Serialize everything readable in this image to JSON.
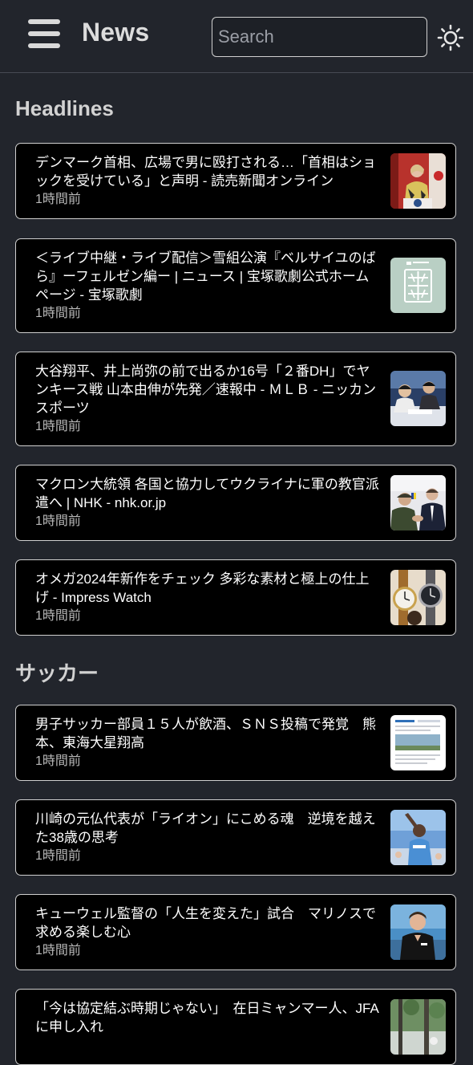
{
  "app": {
    "title": "News"
  },
  "search": {
    "placeholder": "Search",
    "value": ""
  },
  "sections": [
    {
      "title": "Headlines",
      "items": [
        {
          "title": "デンマーク首相、広場で男に殴打される…「首相はショックを受けている」と声明 - 読売新聞オンライン",
          "time": "1時間前",
          "thumb_icon": "woman-at-podium-photo"
        },
        {
          "title": "＜ライブ中継・ライブ配信＞雪組公演『ベルサイユのばら』ーフェルゼン編ー | ニュース | 宝塚歌劇公式ホームページ - 宝塚歌劇",
          "time": "1時間前",
          "thumb_icon": "takarazuka-logo"
        },
        {
          "title": "大谷翔平、井上尚弥の前で出るか16号「２番DH」でヤンキース戦 山本由伸が先発／速報中 - ＭＬＢ - ニッカンスポーツ",
          "time": "1時間前",
          "thumb_icon": "stadium-spectators-photo"
        },
        {
          "title": "マクロン大統領 各国と協力してウクライナに軍の教官派遣へ | NHK - nhk.or.jp",
          "time": "1時間前",
          "thumb_icon": "leaders-handshake-photo"
        },
        {
          "title": "オメガ2024年新作をチェック 多彩な素材と極上の仕上げ - Impress Watch",
          "time": "1時間前",
          "thumb_icon": "wristwatches-photo"
        }
      ]
    },
    {
      "title": "サッカー",
      "items": [
        {
          "title": "男子サッカー部員１５人が飲酒、ＳＮＳ投稿で発覚　熊本、東海大星翔高",
          "time": "1時間前",
          "thumb_icon": "news-article-screenshot"
        },
        {
          "title": "川崎の元仏代表が「ライオン」にこめる魂　逆境を越えた38歳の思考",
          "time": "1時間前",
          "thumb_icon": "player-celebrating-photo"
        },
        {
          "title": "キューウェル監督の「人生を変えた」試合　マリノスで求める楽しむ心",
          "time": "1時間前",
          "thumb_icon": "coach-portrait-photo"
        },
        {
          "title": "「今は協定結ぶ時期じゃない」　在日ミャンマー人、JFAに申し入れ",
          "time": "",
          "thumb_icon": "street-trees-photo"
        }
      ]
    }
  ],
  "icons": {
    "menu": "hamburger-menu-icon",
    "theme": "sun-icon"
  },
  "colors": {
    "page_background": "#22252c",
    "card_background": "#000000",
    "card_border": "#cfcfcf",
    "muted_text": "#b8b8b8",
    "heading_text": "#d2d2d2"
  }
}
